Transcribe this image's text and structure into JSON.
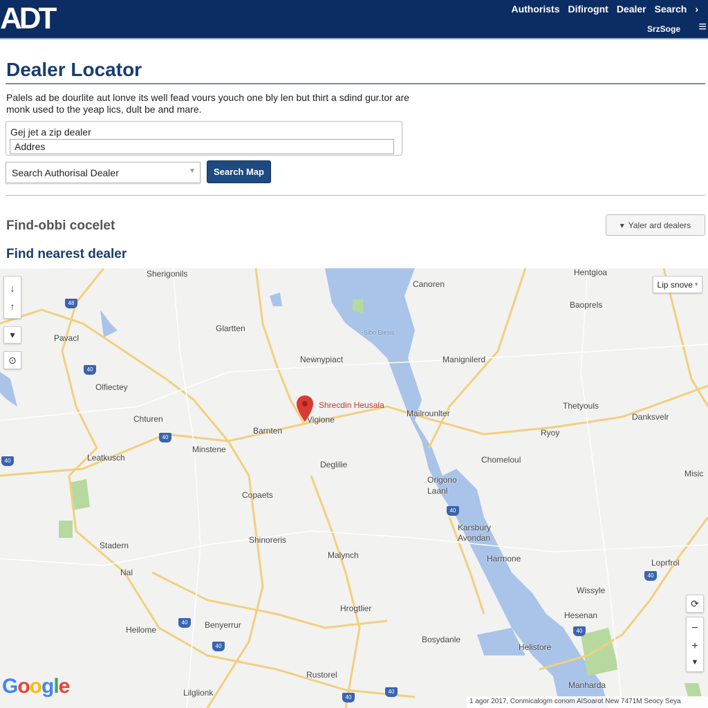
{
  "header": {
    "logo": "ADT",
    "nav": [
      "Authorists",
      "Difirognt",
      "Dealer",
      "Search"
    ],
    "nav_arrow": "›",
    "sub": "SrzSoge",
    "menu_icon": "hamburger-icon"
  },
  "page": {
    "title": "Dealer Locator",
    "description": "Palels ad be dourlite aut lonve its well fead vours youch one bly len but thirt a sdind gur.tor are monk used to the yeap lics, dult be and mare.",
    "zip_label": "Gej jet a zip dealer",
    "address_value": "Addres",
    "select_value": "Search Authorisal Dealer",
    "search_button": "Search Map",
    "section1": "Find-obbi cocelet",
    "filter_button": "Yaler ard dealers",
    "section2": "Find nearest dealer"
  },
  "map": {
    "labels": [
      "Sherigonils",
      "Canoren",
      "Hentgioa",
      "Baoprels",
      "Glartten",
      "Pavacl",
      "Newnypiact",
      "Manignilerd",
      "Olfiectey",
      "Chturen",
      "Barnten",
      "Vigione",
      "Mailrounlter",
      "Thetyouls",
      "Danksvelr",
      "Ryoy",
      "Leatkusch",
      "Minstene",
      "Deglilie",
      "Chomeloul",
      "Misic",
      "Origono Laanl",
      "Copaets",
      "Karsbury Avondan",
      "Shinoreris",
      "Stadern",
      "Malynch",
      "Harmone",
      "Loprfrol",
      "Nal",
      "Wissyle",
      "Hrogtlier",
      "Heilome",
      "Benyerrur",
      "Hesenan",
      "Bosydanle",
      "Helistore",
      "Rustorel",
      "Lilglionk",
      "Manharda",
      "Sibo Blesis"
    ],
    "marker_label": "Shrecdin Heusala",
    "layer_button": "Lip snove",
    "google": "Google",
    "attribution": "1 agor 2017, Conmicalogm conom AlSoarot New 7471M Seocy Seya",
    "colors": {
      "water": "#a9c4e8",
      "road": "#f3cf7d",
      "park": "#b7d9a0",
      "marker": "#d93a32",
      "brand": "#0b2d63"
    }
  }
}
